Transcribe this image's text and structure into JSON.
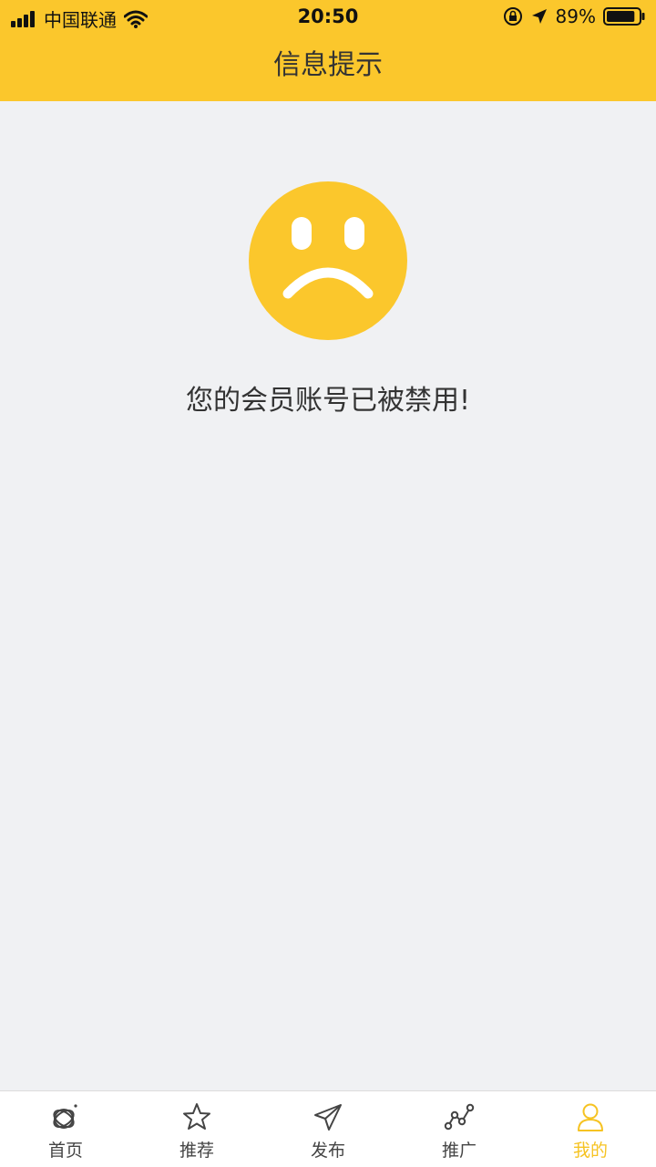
{
  "status_bar": {
    "carrier": "中国联通",
    "time": "20:50",
    "battery_percent": "89%",
    "battery_level": 0.89
  },
  "header": {
    "title": "信息提示"
  },
  "main": {
    "icon": "sad-face-icon",
    "message": "您的会员账号已被禁用!"
  },
  "tabbar": {
    "tabs": [
      {
        "label": "首页",
        "icon": "home-orbit-icon"
      },
      {
        "label": "推荐",
        "icon": "star-icon"
      },
      {
        "label": "发布",
        "icon": "paper-plane-icon"
      },
      {
        "label": "推广",
        "icon": "trend-line-icon"
      },
      {
        "label": "我的",
        "icon": "user-icon",
        "active": true
      }
    ]
  },
  "colors": {
    "accent": "#fbc72c",
    "background": "#f0f1f3",
    "active_tab": "#f6c322"
  }
}
